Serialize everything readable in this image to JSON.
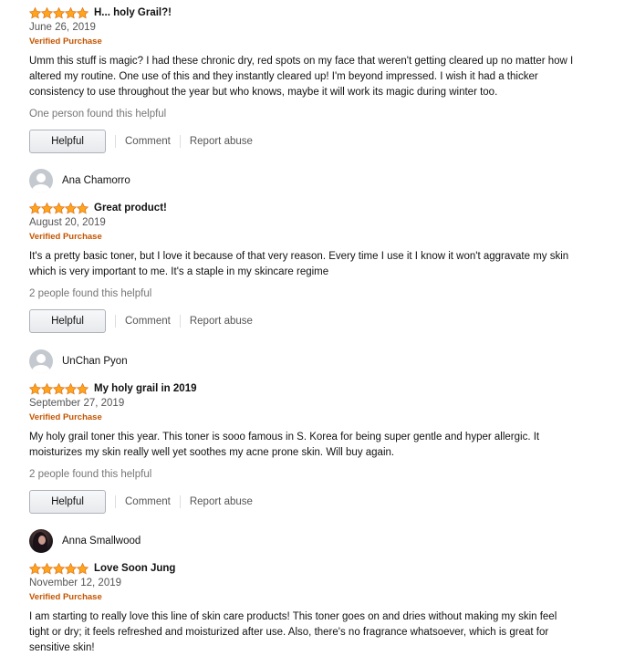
{
  "colors": {
    "star": "#ffa41c",
    "verified": "#c45500",
    "muted": "#767676"
  },
  "reviews": [
    {
      "reviewer": "",
      "rating": 5,
      "title": "H... holy Grail?!",
      "date": "June 26, 2019",
      "verified": "Verified Purchase",
      "body": "Umm this stuff is magic? I had these chronic dry, red spots on my face that weren't getting cleared up no matter how I altered my routine. One use of this and they instantly cleared up! I'm beyond impressed. I wish it had a thicker consistency to use throughout the year but who knows, maybe it will work its magic during winter too.",
      "helpful_count": "One person found this helpful",
      "helpful_label": "Helpful",
      "comment_label": "Comment",
      "report_label": "Report abuse"
    },
    {
      "reviewer": "Ana Chamorro",
      "rating": 5,
      "title": "Great product!",
      "date": "August 20, 2019",
      "verified": "Verified Purchase",
      "body": "It's a pretty basic toner, but I love it because of that very reason. Every time I use it I know it won't aggravate my skin which is very important to me. It's a staple in my skincare regime",
      "helpful_count": "2 people found this helpful",
      "helpful_label": "Helpful",
      "comment_label": "Comment",
      "report_label": "Report abuse"
    },
    {
      "reviewer": "UnChan Pyon",
      "rating": 5,
      "title": "My holy grail in 2019",
      "date": "September 27, 2019",
      "verified": "Verified Purchase",
      "body": "My holy grail toner this year. This toner is sooo famous in S. Korea for being super gentle and hyper allergic. It moisturizes my skin really well yet soothes my acne prone skin. Will buy again.",
      "helpful_count": "2 people found this helpful",
      "helpful_label": "Helpful",
      "comment_label": "Comment",
      "report_label": "Report abuse"
    },
    {
      "reviewer": "Anna Smallwood",
      "rating": 5,
      "title": "Love Soon Jung",
      "date": "November 12, 2019",
      "verified": "Verified Purchase",
      "body": "I am starting to really love this line of skin care products! This toner goes on and dries without making my skin feel tight or dry; it feels refreshed and moisturized after use. Also, there's no fragrance whatsoever, which is great for sensitive skin!",
      "helpful_count": "",
      "helpful_label": "",
      "comment_label": "",
      "report_label": ""
    }
  ]
}
